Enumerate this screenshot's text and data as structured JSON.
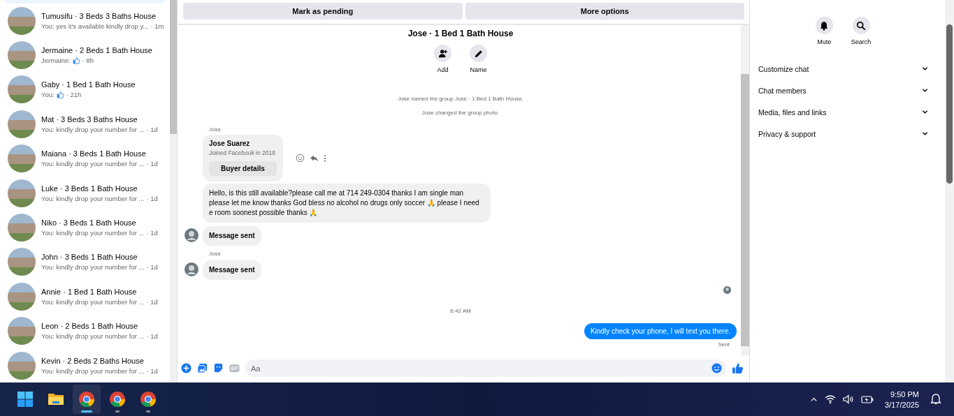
{
  "conversations": [
    {
      "title": "Tumusifu · 3 Beds 3 Baths House",
      "kind": "text",
      "preview": "You: yes it's available kindly drop y...",
      "time": "· 1m"
    },
    {
      "title": "Jermaine · 2 Beds 1 Bath House",
      "kind": "like",
      "preview": "Jermaine:",
      "time": "· 8h"
    },
    {
      "title": "Gaby · 1 Bed 1 Bath House",
      "kind": "like",
      "preview": "You:",
      "time": "· 21h"
    },
    {
      "title": "Mat · 3 Beds 3 Baths House",
      "kind": "text",
      "preview": "You: kindly drop your number for ...",
      "time": "· 1d"
    },
    {
      "title": "Maiana · 3 Beds 1 Bath House",
      "kind": "text",
      "preview": "You: kindly drop your number for ...",
      "time": "· 1d"
    },
    {
      "title": "Luke · 3 Beds 1 Bath House",
      "kind": "text",
      "preview": "You: kindly drop your number for ...",
      "time": "· 1d"
    },
    {
      "title": "Niko · 3 Beds 1 Bath House",
      "kind": "text",
      "preview": "You: kindly drop your number for ...",
      "time": "· 1d"
    },
    {
      "title": "John · 3 Beds 1 Bath House",
      "kind": "text",
      "preview": "You: kindly drop your number for ...",
      "time": "· 1d"
    },
    {
      "title": "Annie · 1 Bed 1 Bath House",
      "kind": "text",
      "preview": "You: kindly drop your number for ...",
      "time": "· 1d"
    },
    {
      "title": "Leon · 2 Beds 1 Bath House",
      "kind": "text",
      "preview": "You: kindly drop your number for ...",
      "time": "· 1d"
    },
    {
      "title": "Kevin · 2 Beds 2 Baths House",
      "kind": "text",
      "preview": "You: kindly drop your number for ...",
      "time": "· 1d"
    }
  ],
  "actions": [
    "Mark as pending",
    "More options"
  ],
  "chat": {
    "title": "Jose · 1 Bed 1 Bath House",
    "group_actions": [
      {
        "kind": "add",
        "label": "Add"
      },
      {
        "kind": "name",
        "label": "Name"
      }
    ],
    "messages": [
      {
        "kind": "system",
        "text": "Jose named the group Jose · 1 Bed 1 Bath House."
      },
      {
        "kind": "system",
        "text": "Jose changed the group photo."
      },
      {
        "kind": "sender",
        "text": "Jose"
      },
      {
        "kind": "buyer_card",
        "name": "Jose Suarez",
        "text": "Joined Facebook in 2018",
        "button": "Buyer details"
      },
      {
        "kind": "incoming",
        "avatar": false,
        "bold": false,
        "text": "Hello, is this still available?please call me at 714 249-0304 thanks I am single man please let me know thanks God bless no alcohol no drugs only soccer 🙏 please I need e room soonest possible thanks 🙏"
      },
      {
        "kind": "incoming",
        "avatar": true,
        "bold": true,
        "text": "Message sent"
      },
      {
        "kind": "sender",
        "text": "Jose"
      },
      {
        "kind": "incoming",
        "avatar": true,
        "bold": true,
        "text": "Message sent"
      },
      {
        "kind": "seen"
      },
      {
        "kind": "timestamp",
        "text": "6:42 AM"
      },
      {
        "kind": "outgoing",
        "text": "Kindly check your phone, I will text you there."
      },
      {
        "kind": "status",
        "text": "Sent"
      }
    ],
    "composer": {
      "placeholder": "Aa"
    }
  },
  "details": {
    "actions": [
      {
        "kind": "mute",
        "label": "Mute"
      },
      {
        "kind": "search",
        "label": "Search"
      }
    ],
    "sections": [
      "Customize chat",
      "Chat members",
      "Media, files and links",
      "Privacy & support"
    ]
  },
  "taskbar": {
    "apps": [
      {
        "kind": "start",
        "selected": false
      },
      {
        "kind": "folder",
        "selected": false
      },
      {
        "kind": "browser",
        "selected": true
      },
      {
        "kind": "browser",
        "selected": false
      },
      {
        "kind": "browser",
        "selected": false
      }
    ],
    "time": "9:50 PM",
    "date": "3/17/2025"
  }
}
